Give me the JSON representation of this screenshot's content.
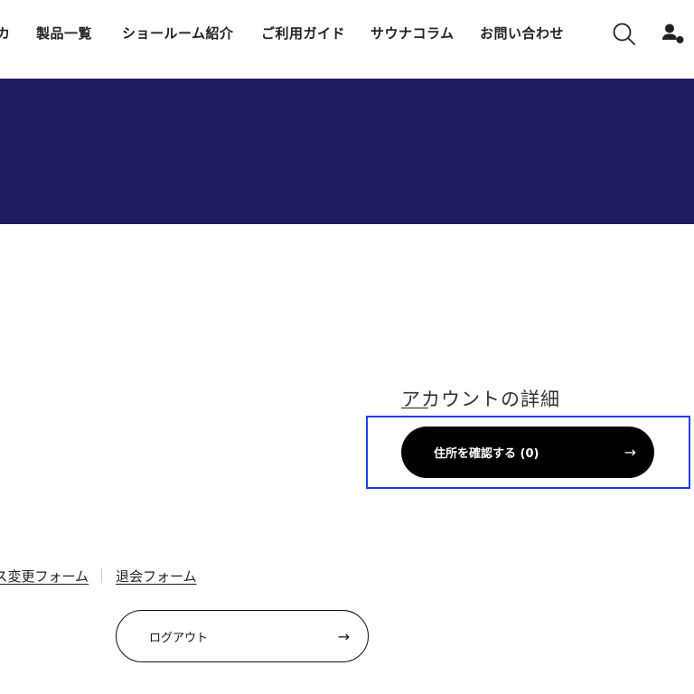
{
  "colors": {
    "banner": "#1f1c5f",
    "primary_button": "#000000",
    "focus_outline": "#1a3ee8",
    "text": "#222222"
  },
  "header": {
    "nav": [
      {
        "label": "カ"
      },
      {
        "label": "製品一覧"
      },
      {
        "label": "ショールーム紹介"
      },
      {
        "label": "ご利用ガイド"
      },
      {
        "label": "サウナコラム"
      },
      {
        "label": "お問い合わせ"
      }
    ],
    "icons": {
      "search": "search-icon",
      "account": "user-icon"
    }
  },
  "account": {
    "title": "アカウントの詳細",
    "address_button": "住所を確認する (0)",
    "arrow": "→"
  },
  "links": {
    "address_change": "ス変更フォーム",
    "withdraw": "退会フォーム"
  },
  "logout": {
    "label": "ログアウト",
    "arrow": "→"
  }
}
